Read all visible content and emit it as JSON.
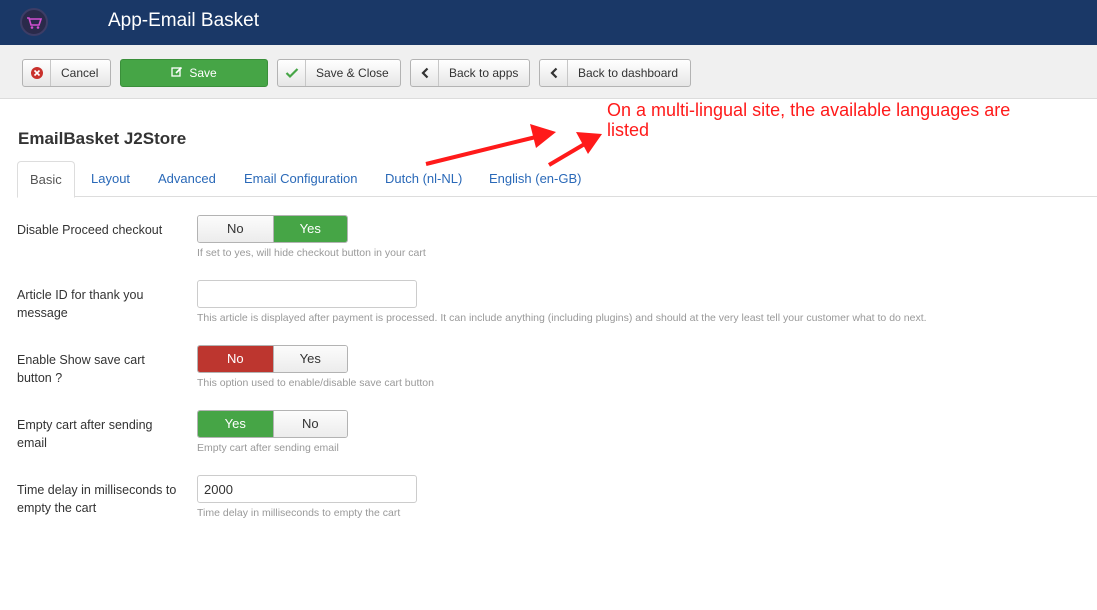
{
  "app": {
    "title": "App-Email Basket",
    "logo_icon": "shopping-basket-icon"
  },
  "toolbar": {
    "cancel_label": "Cancel",
    "save_label": "Save",
    "save_close_label": "Save & Close",
    "back_apps_label": "Back to apps",
    "back_dashboard_label": "Back to dashboard"
  },
  "annotation": {
    "text": "On a multi-lingual site, the available languages are listed",
    "color": "#ff1a1a"
  },
  "page": {
    "title": "EmailBasket J2Store"
  },
  "tabs": [
    {
      "label": "Basic"
    },
    {
      "label": "Layout"
    },
    {
      "label": "Advanced"
    },
    {
      "label": "Email Configuration"
    },
    {
      "label": "Dutch (nl-NL)"
    },
    {
      "label": "English (en-GB)"
    }
  ],
  "form": {
    "disable_proceed": {
      "label": "Disable Proceed checkout",
      "options": [
        "No",
        "Yes"
      ],
      "selected": "Yes",
      "help": "If set to yes, will hide checkout button in your cart"
    },
    "article_id": {
      "label": "Article ID for thank you message",
      "value": "",
      "help": "This article is displayed after payment is processed. It can include anything (including plugins) and should at the very least tell your customer what to do next."
    },
    "show_save_cart": {
      "label": "Enable Show save cart button ?",
      "options": [
        "No",
        "Yes"
      ],
      "selected": "No",
      "help": "This option used to enable/disable save cart button"
    },
    "empty_cart": {
      "label": "Empty cart after sending email",
      "options": [
        "Yes",
        "No"
      ],
      "selected": "Yes",
      "help": "Empty cart after sending email"
    },
    "time_delay": {
      "label": "Time delay in milliseconds to empty the cart",
      "value": "2000",
      "help": "Time delay in milliseconds to empty the cart"
    }
  },
  "colors": {
    "header": "#1a3867",
    "success": "#46a546",
    "danger": "#bd362f",
    "link": "#2a69b8"
  }
}
